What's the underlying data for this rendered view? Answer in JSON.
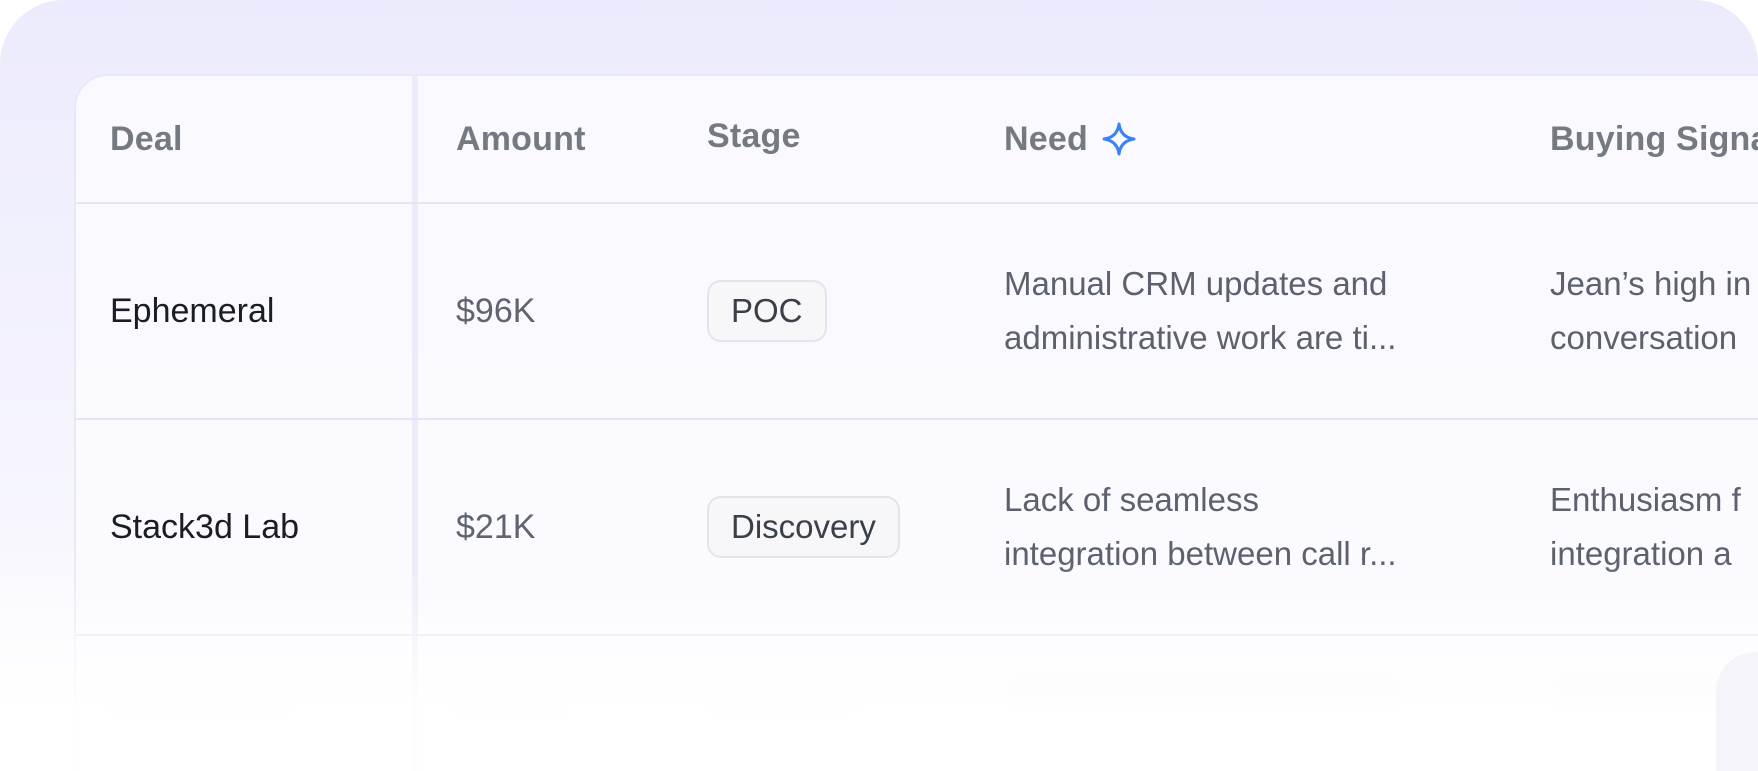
{
  "table": {
    "headers": {
      "deal": "Deal",
      "amount": "Amount",
      "stage": "Stage",
      "need": "Need",
      "buying_signals": "Buying Signa"
    },
    "need_header_icon": "sparkle-icon",
    "accent_color": "#3b82f6",
    "rows": [
      {
        "deal": "Ephemeral",
        "amount": "$96K",
        "stage": "POC",
        "need_line1": "Manual CRM updates and",
        "need_line2": "administrative work are ti...",
        "signal_line1": "Jean’s high in",
        "signal_line2": "conversation"
      },
      {
        "deal": "Stack3d Lab",
        "amount": "$21K",
        "stage": "Discovery",
        "need_line1": "Lack of seamless",
        "need_line2": "integration between call r...",
        "signal_line1": "Enthusiasm f",
        "signal_line2": "integration a"
      }
    ]
  }
}
